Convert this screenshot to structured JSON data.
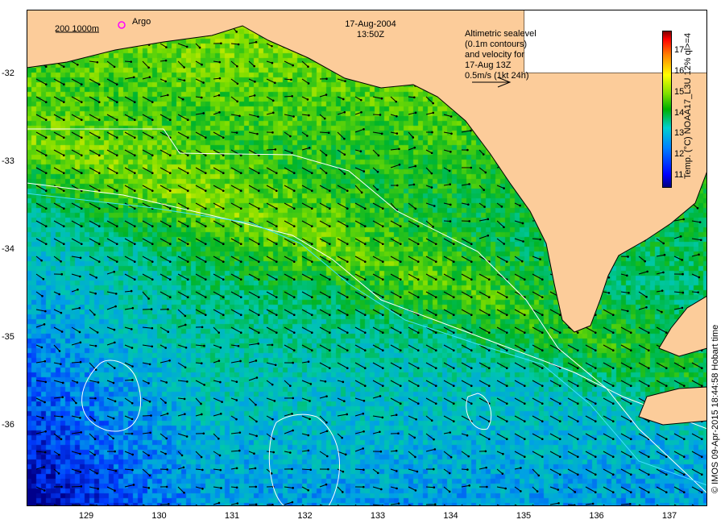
{
  "title": {
    "date": "17-Aug-2004",
    "time": "13:50Z"
  },
  "scale_bar": {
    "label": "200  1000m"
  },
  "argo": {
    "label": "Argo",
    "color": "#ff00ff"
  },
  "altimetry_note": [
    "Altimetric sealevel",
    "(0.1m contours)",
    "and velocity for",
    "17-Aug 13Z",
    "0.5m/s (1kt 24h)"
  ],
  "colorbar": {
    "label": "Temp. (°C) NOAA17_L3U 12% ql>=4",
    "ticks": [
      "11",
      "12",
      "13",
      "14",
      "15",
      "16",
      "17"
    ],
    "range": [
      10.5,
      17.8
    ]
  },
  "axes": {
    "x_ticks": [
      "129",
      "130",
      "131",
      "132",
      "133",
      "134",
      "135",
      "136",
      "137"
    ],
    "y_ticks": [
      "-32",
      "-33",
      "-34",
      "-35",
      "-36"
    ]
  },
  "credit": "© IMOS 09-Apr-2015 18:44:58 Hobart time",
  "colors": {
    "land": "#fccc9a",
    "contour": "#ffffff",
    "cyan_contour": "#40e0ff"
  }
}
